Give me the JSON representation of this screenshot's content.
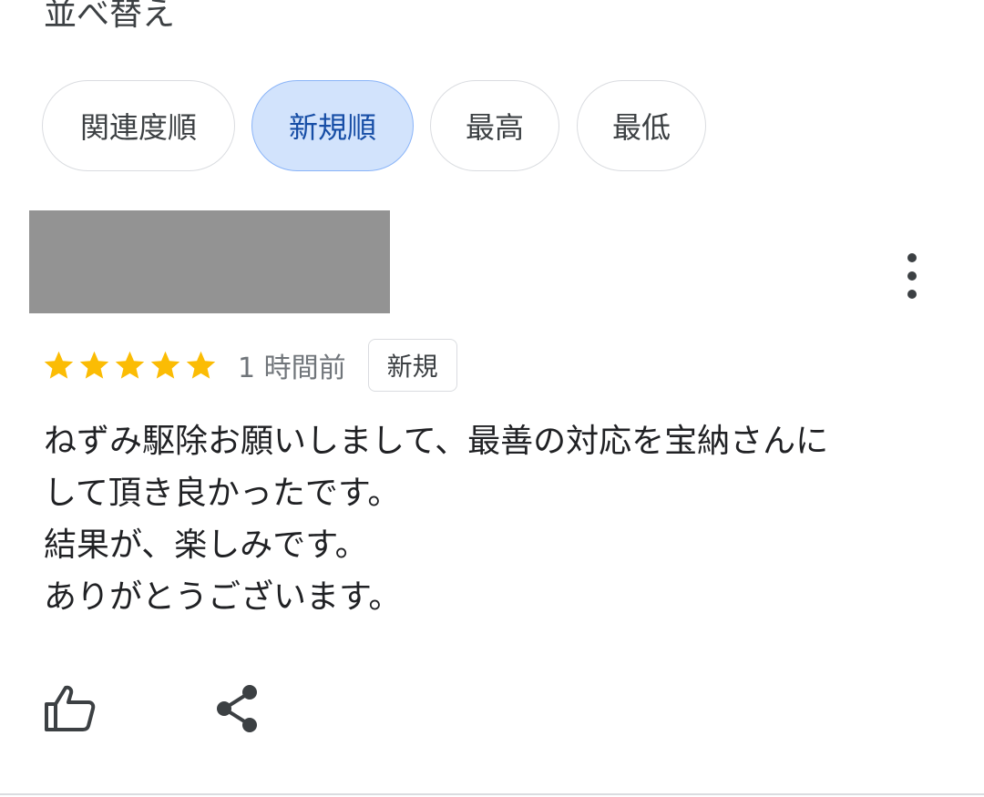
{
  "sort": {
    "title": "並べ替え",
    "options": [
      {
        "label": "関連度順",
        "selected": false
      },
      {
        "label": "新規順",
        "selected": true
      },
      {
        "label": "最高",
        "selected": false
      },
      {
        "label": "最低",
        "selected": false
      }
    ]
  },
  "review": {
    "rating": 5,
    "rating_max": 5,
    "time": "1 時間前",
    "badge": "新規",
    "text_lines": [
      "ねずみ駆除お願いしまして、最善の対応を宝納さんに",
      "して頂き良かったです。",
      "結果が、楽しみです。",
      "ありがとうございます。"
    ],
    "reviewer_name_redacted": true
  },
  "actions": {
    "like_icon": "thumb-up-icon",
    "share_icon": "share-icon",
    "menu_icon": "more-vert-icon"
  },
  "colors": {
    "star": "#fbbc04",
    "chip_selected_bg": "#d2e3fc",
    "chip_selected_text": "#174ea6",
    "chip_border": "#dadce0",
    "redaction": "#939393",
    "avatar": "#4e8e4a"
  }
}
